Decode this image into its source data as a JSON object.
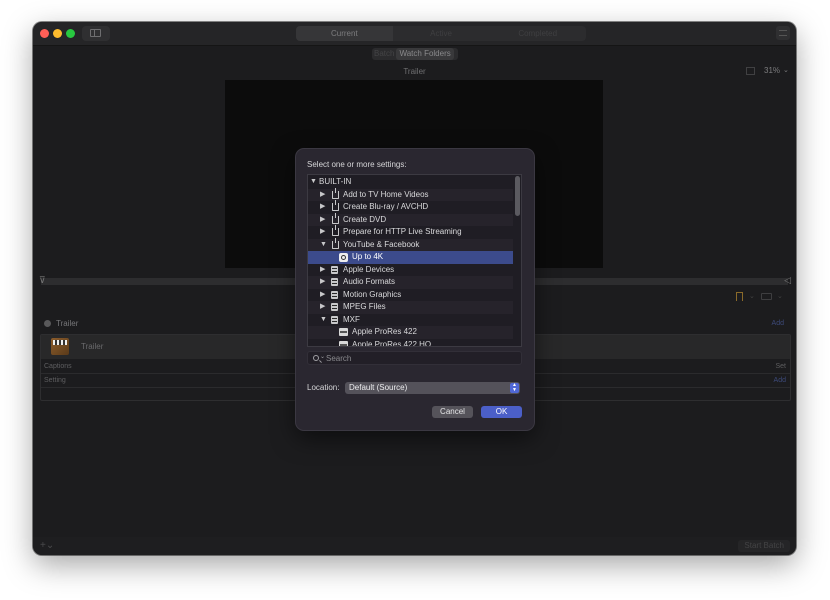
{
  "toolbar": {
    "tabs": [
      "Current",
      "Active",
      "Completed"
    ],
    "active_tab_index": 0
  },
  "mode": {
    "options": [
      "Batch",
      "Watch Folders"
    ],
    "active": "Watch Folders"
  },
  "viewer": {
    "title": "Trailer",
    "zoom": "31%"
  },
  "batch": {
    "header_title": "Trailer",
    "add_label": "Add",
    "job": {
      "title": "Trailer",
      "rows": [
        {
          "label": "Captions",
          "action": "Set"
        },
        {
          "label": "Setting",
          "action": "Add"
        }
      ]
    }
  },
  "bottom": {
    "start_batch_label": "Start Batch"
  },
  "dialog": {
    "prompt": "Select one or more settings:",
    "tree": [
      {
        "label": "BUILT-IN",
        "level": 0,
        "expanded": true,
        "icon": "none"
      },
      {
        "label": "Add to TV Home Videos",
        "level": 1,
        "expanded": false,
        "icon": "share-icon"
      },
      {
        "label": "Create Blu-ray / AVCHD",
        "level": 1,
        "expanded": false,
        "icon": "share-icon"
      },
      {
        "label": "Create DVD",
        "level": 1,
        "expanded": false,
        "icon": "share-icon"
      },
      {
        "label": "Prepare for HTTP Live Streaming",
        "level": 1,
        "expanded": false,
        "icon": "share-icon"
      },
      {
        "label": "YouTube & Facebook",
        "level": 1,
        "expanded": true,
        "icon": "share-icon"
      },
      {
        "label": "Up to 4K",
        "level": 2,
        "expanded": null,
        "icon": "youtube-setting-icon",
        "selected": true
      },
      {
        "label": "Apple Devices",
        "level": 1,
        "expanded": false,
        "icon": "compressor-icon"
      },
      {
        "label": "Audio Formats",
        "level": 1,
        "expanded": false,
        "icon": "compressor-icon"
      },
      {
        "label": "Motion Graphics",
        "level": 1,
        "expanded": false,
        "icon": "compressor-icon"
      },
      {
        "label": "MPEG Files",
        "level": 1,
        "expanded": false,
        "icon": "compressor-icon"
      },
      {
        "label": "MXF",
        "level": 1,
        "expanded": true,
        "icon": "compressor-icon"
      },
      {
        "label": "Apple ProRes 422",
        "level": 2,
        "expanded": null,
        "icon": "prores-icon"
      },
      {
        "label": "Apple ProRes 422 HQ",
        "level": 2,
        "expanded": null,
        "icon": "prores-icon"
      }
    ],
    "search_placeholder": "Search",
    "location_label": "Location:",
    "location_value": "Default (Source)",
    "cancel_label": "Cancel",
    "ok_label": "OK"
  }
}
